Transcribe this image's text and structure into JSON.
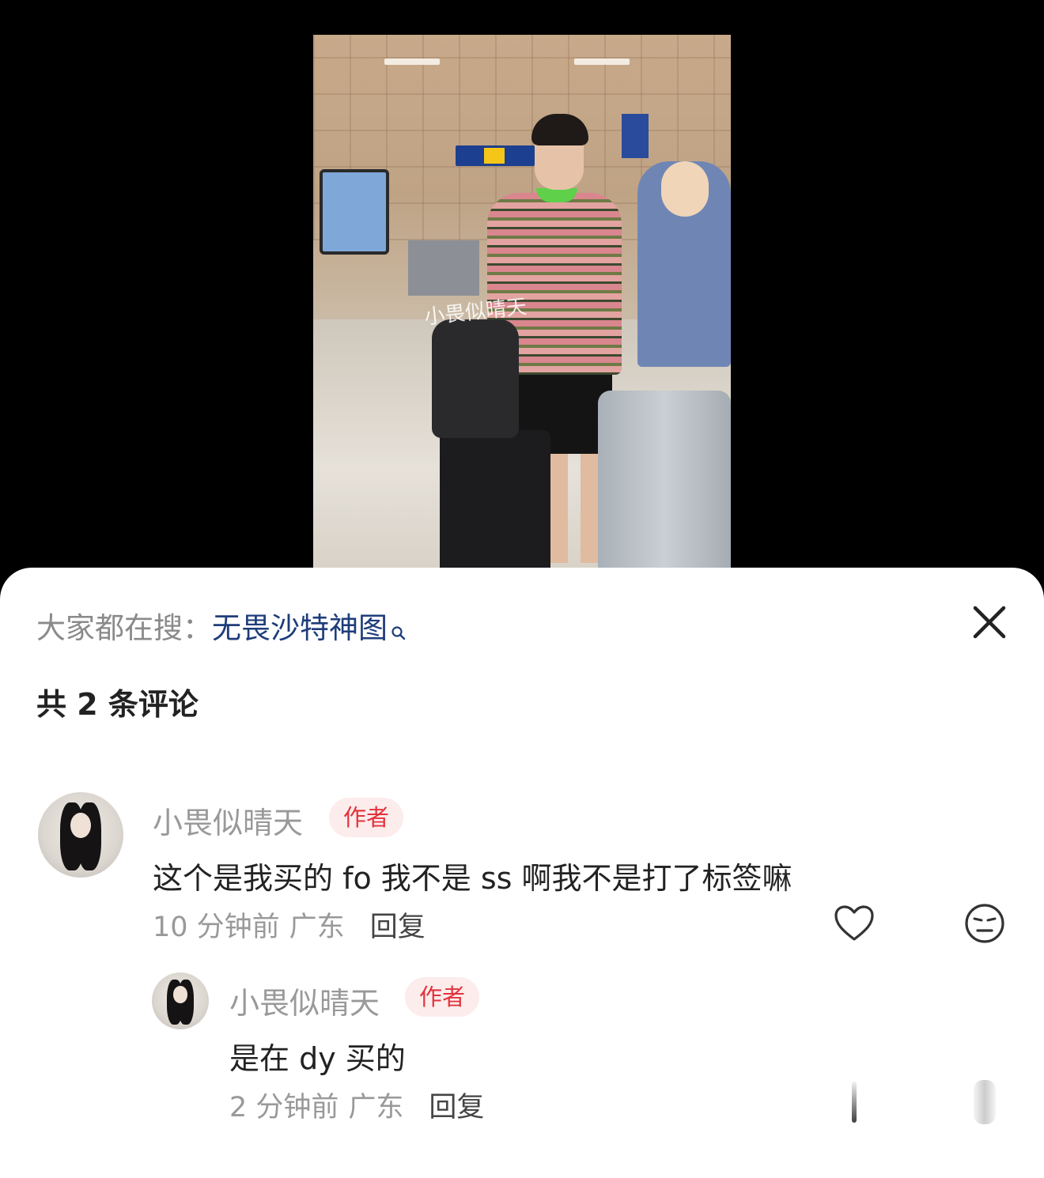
{
  "search": {
    "prefix": "大家都在搜：",
    "term": "无畏沙特神图"
  },
  "video": {
    "watermark": "小畏似晴天"
  },
  "comments_header": {
    "count_label": "共 2 条评论"
  },
  "comments": [
    {
      "username": "小畏似晴天",
      "badge": "作者",
      "text": "这个是我买的 fo 我不是 ss 啊我不是打了标签嘛",
      "time": "10 分钟前",
      "location": "广东",
      "reply_label": "回复"
    },
    {
      "username": "小畏似晴天",
      "badge": "作者",
      "text": "是在 dy 买的",
      "time": "2 分钟前",
      "location": "广东",
      "reply_label": "回复"
    }
  ],
  "colors": {
    "badge_text": "#e2323c",
    "badge_bg": "#fdecec",
    "search_term": "#1e3d7a"
  },
  "icons": [
    "search-icon",
    "close-icon",
    "heart-icon",
    "dislike-face-icon"
  ]
}
